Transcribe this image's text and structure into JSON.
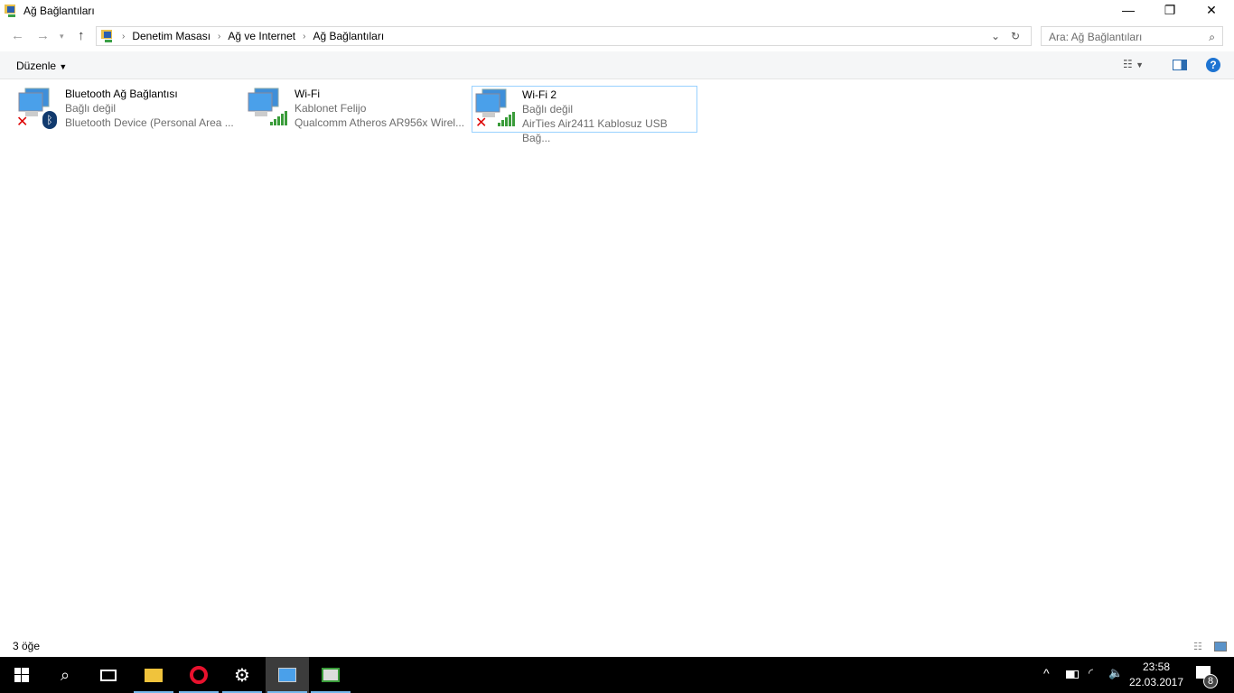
{
  "window": {
    "title": "Ağ Bağlantıları"
  },
  "address": {
    "crumbs": [
      "Denetim Masası",
      "Ağ ve Internet",
      "Ağ Bağlantıları"
    ],
    "search_placeholder": "Ara: Ağ Bağlantıları"
  },
  "toolbar": {
    "organize": "Düzenle"
  },
  "connections": [
    {
      "name": "Bluetooth Ağ Bağlantısı",
      "status": "Bağlı değil",
      "device": "Bluetooth Device (Personal Area ...",
      "state": "disconnected",
      "overlay": "bluetooth"
    },
    {
      "name": "Wi-Fi",
      "status": "Kablonet Felijo",
      "device": "Qualcomm Atheros AR956x Wirel...",
      "state": "connected",
      "overlay": "signal"
    },
    {
      "name": "Wi-Fi 2",
      "status": "Bağlı değil",
      "device": "AirTies Air2411 Kablosuz USB Bağ...",
      "state": "disconnected",
      "overlay": "signal"
    }
  ],
  "statusbar": {
    "count": "3 öğe"
  },
  "taskbar": {
    "time": "23:58",
    "date": "22.03.2017",
    "notifications": "8"
  },
  "colors": {
    "accent": "#0078d7",
    "selection": "#99d1ff"
  }
}
